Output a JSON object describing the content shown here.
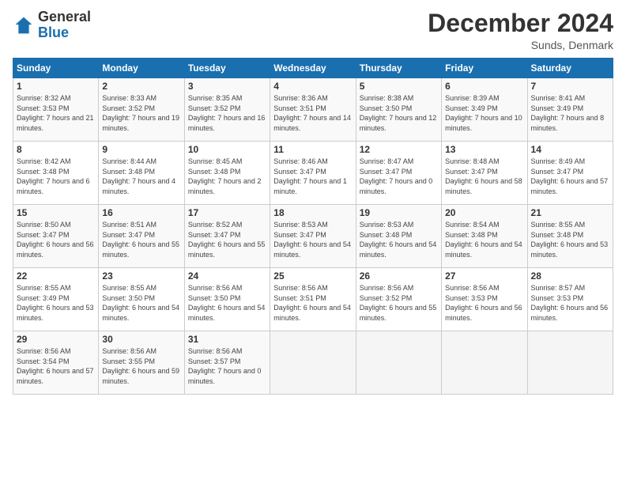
{
  "logo": {
    "general": "General",
    "blue": "Blue"
  },
  "title": "December 2024",
  "location": "Sunds, Denmark",
  "days_header": [
    "Sunday",
    "Monday",
    "Tuesday",
    "Wednesday",
    "Thursday",
    "Friday",
    "Saturday"
  ],
  "weeks": [
    [
      {
        "day": "1",
        "sunrise": "Sunrise: 8:32 AM",
        "sunset": "Sunset: 3:53 PM",
        "daylight": "Daylight: 7 hours and 21 minutes."
      },
      {
        "day": "2",
        "sunrise": "Sunrise: 8:33 AM",
        "sunset": "Sunset: 3:52 PM",
        "daylight": "Daylight: 7 hours and 19 minutes."
      },
      {
        "day": "3",
        "sunrise": "Sunrise: 8:35 AM",
        "sunset": "Sunset: 3:52 PM",
        "daylight": "Daylight: 7 hours and 16 minutes."
      },
      {
        "day": "4",
        "sunrise": "Sunrise: 8:36 AM",
        "sunset": "Sunset: 3:51 PM",
        "daylight": "Daylight: 7 hours and 14 minutes."
      },
      {
        "day": "5",
        "sunrise": "Sunrise: 8:38 AM",
        "sunset": "Sunset: 3:50 PM",
        "daylight": "Daylight: 7 hours and 12 minutes."
      },
      {
        "day": "6",
        "sunrise": "Sunrise: 8:39 AM",
        "sunset": "Sunset: 3:49 PM",
        "daylight": "Daylight: 7 hours and 10 minutes."
      },
      {
        "day": "7",
        "sunrise": "Sunrise: 8:41 AM",
        "sunset": "Sunset: 3:49 PM",
        "daylight": "Daylight: 7 hours and 8 minutes."
      }
    ],
    [
      {
        "day": "8",
        "sunrise": "Sunrise: 8:42 AM",
        "sunset": "Sunset: 3:48 PM",
        "daylight": "Daylight: 7 hours and 6 minutes."
      },
      {
        "day": "9",
        "sunrise": "Sunrise: 8:44 AM",
        "sunset": "Sunset: 3:48 PM",
        "daylight": "Daylight: 7 hours and 4 minutes."
      },
      {
        "day": "10",
        "sunrise": "Sunrise: 8:45 AM",
        "sunset": "Sunset: 3:48 PM",
        "daylight": "Daylight: 7 hours and 2 minutes."
      },
      {
        "day": "11",
        "sunrise": "Sunrise: 8:46 AM",
        "sunset": "Sunset: 3:47 PM",
        "daylight": "Daylight: 7 hours and 1 minute."
      },
      {
        "day": "12",
        "sunrise": "Sunrise: 8:47 AM",
        "sunset": "Sunset: 3:47 PM",
        "daylight": "Daylight: 7 hours and 0 minutes."
      },
      {
        "day": "13",
        "sunrise": "Sunrise: 8:48 AM",
        "sunset": "Sunset: 3:47 PM",
        "daylight": "Daylight: 6 hours and 58 minutes."
      },
      {
        "day": "14",
        "sunrise": "Sunrise: 8:49 AM",
        "sunset": "Sunset: 3:47 PM",
        "daylight": "Daylight: 6 hours and 57 minutes."
      }
    ],
    [
      {
        "day": "15",
        "sunrise": "Sunrise: 8:50 AM",
        "sunset": "Sunset: 3:47 PM",
        "daylight": "Daylight: 6 hours and 56 minutes."
      },
      {
        "day": "16",
        "sunrise": "Sunrise: 8:51 AM",
        "sunset": "Sunset: 3:47 PM",
        "daylight": "Daylight: 6 hours and 55 minutes."
      },
      {
        "day": "17",
        "sunrise": "Sunrise: 8:52 AM",
        "sunset": "Sunset: 3:47 PM",
        "daylight": "Daylight: 6 hours and 55 minutes."
      },
      {
        "day": "18",
        "sunrise": "Sunrise: 8:53 AM",
        "sunset": "Sunset: 3:47 PM",
        "daylight": "Daylight: 6 hours and 54 minutes."
      },
      {
        "day": "19",
        "sunrise": "Sunrise: 8:53 AM",
        "sunset": "Sunset: 3:48 PM",
        "daylight": "Daylight: 6 hours and 54 minutes."
      },
      {
        "day": "20",
        "sunrise": "Sunrise: 8:54 AM",
        "sunset": "Sunset: 3:48 PM",
        "daylight": "Daylight: 6 hours and 54 minutes."
      },
      {
        "day": "21",
        "sunrise": "Sunrise: 8:55 AM",
        "sunset": "Sunset: 3:48 PM",
        "daylight": "Daylight: 6 hours and 53 minutes."
      }
    ],
    [
      {
        "day": "22",
        "sunrise": "Sunrise: 8:55 AM",
        "sunset": "Sunset: 3:49 PM",
        "daylight": "Daylight: 6 hours and 53 minutes."
      },
      {
        "day": "23",
        "sunrise": "Sunrise: 8:55 AM",
        "sunset": "Sunset: 3:50 PM",
        "daylight": "Daylight: 6 hours and 54 minutes."
      },
      {
        "day": "24",
        "sunrise": "Sunrise: 8:56 AM",
        "sunset": "Sunset: 3:50 PM",
        "daylight": "Daylight: 6 hours and 54 minutes."
      },
      {
        "day": "25",
        "sunrise": "Sunrise: 8:56 AM",
        "sunset": "Sunset: 3:51 PM",
        "daylight": "Daylight: 6 hours and 54 minutes."
      },
      {
        "day": "26",
        "sunrise": "Sunrise: 8:56 AM",
        "sunset": "Sunset: 3:52 PM",
        "daylight": "Daylight: 6 hours and 55 minutes."
      },
      {
        "day": "27",
        "sunrise": "Sunrise: 8:56 AM",
        "sunset": "Sunset: 3:53 PM",
        "daylight": "Daylight: 6 hours and 56 minutes."
      },
      {
        "day": "28",
        "sunrise": "Sunrise: 8:57 AM",
        "sunset": "Sunset: 3:53 PM",
        "daylight": "Daylight: 6 hours and 56 minutes."
      }
    ],
    [
      {
        "day": "29",
        "sunrise": "Sunrise: 8:56 AM",
        "sunset": "Sunset: 3:54 PM",
        "daylight": "Daylight: 6 hours and 57 minutes."
      },
      {
        "day": "30",
        "sunrise": "Sunrise: 8:56 AM",
        "sunset": "Sunset: 3:55 PM",
        "daylight": "Daylight: 6 hours and 59 minutes."
      },
      {
        "day": "31",
        "sunrise": "Sunrise: 8:56 AM",
        "sunset": "Sunset: 3:57 PM",
        "daylight": "Daylight: 7 hours and 0 minutes."
      },
      null,
      null,
      null,
      null
    ]
  ]
}
